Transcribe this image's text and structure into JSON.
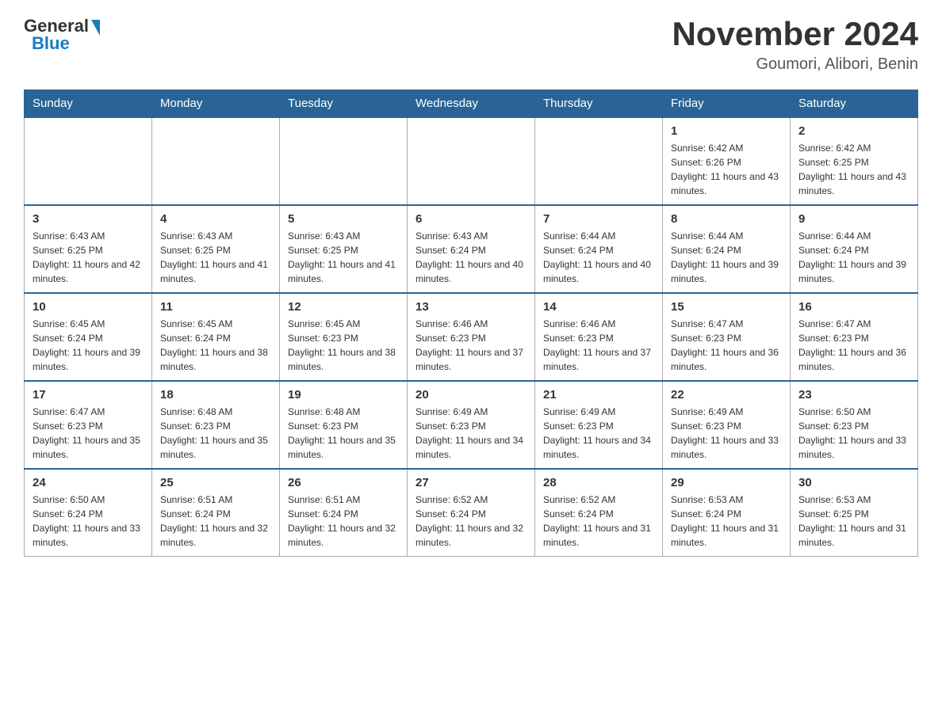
{
  "logo": {
    "general": "General",
    "blue": "Blue"
  },
  "title": "November 2024",
  "subtitle": "Goumori, Alibori, Benin",
  "days_of_week": [
    "Sunday",
    "Monday",
    "Tuesday",
    "Wednesday",
    "Thursday",
    "Friday",
    "Saturday"
  ],
  "weeks": [
    [
      {
        "day": "",
        "info": ""
      },
      {
        "day": "",
        "info": ""
      },
      {
        "day": "",
        "info": ""
      },
      {
        "day": "",
        "info": ""
      },
      {
        "day": "",
        "info": ""
      },
      {
        "day": "1",
        "info": "Sunrise: 6:42 AM\nSunset: 6:26 PM\nDaylight: 11 hours and 43 minutes."
      },
      {
        "day": "2",
        "info": "Sunrise: 6:42 AM\nSunset: 6:25 PM\nDaylight: 11 hours and 43 minutes."
      }
    ],
    [
      {
        "day": "3",
        "info": "Sunrise: 6:43 AM\nSunset: 6:25 PM\nDaylight: 11 hours and 42 minutes."
      },
      {
        "day": "4",
        "info": "Sunrise: 6:43 AM\nSunset: 6:25 PM\nDaylight: 11 hours and 41 minutes."
      },
      {
        "day": "5",
        "info": "Sunrise: 6:43 AM\nSunset: 6:25 PM\nDaylight: 11 hours and 41 minutes."
      },
      {
        "day": "6",
        "info": "Sunrise: 6:43 AM\nSunset: 6:24 PM\nDaylight: 11 hours and 40 minutes."
      },
      {
        "day": "7",
        "info": "Sunrise: 6:44 AM\nSunset: 6:24 PM\nDaylight: 11 hours and 40 minutes."
      },
      {
        "day": "8",
        "info": "Sunrise: 6:44 AM\nSunset: 6:24 PM\nDaylight: 11 hours and 39 minutes."
      },
      {
        "day": "9",
        "info": "Sunrise: 6:44 AM\nSunset: 6:24 PM\nDaylight: 11 hours and 39 minutes."
      }
    ],
    [
      {
        "day": "10",
        "info": "Sunrise: 6:45 AM\nSunset: 6:24 PM\nDaylight: 11 hours and 39 minutes."
      },
      {
        "day": "11",
        "info": "Sunrise: 6:45 AM\nSunset: 6:24 PM\nDaylight: 11 hours and 38 minutes."
      },
      {
        "day": "12",
        "info": "Sunrise: 6:45 AM\nSunset: 6:23 PM\nDaylight: 11 hours and 38 minutes."
      },
      {
        "day": "13",
        "info": "Sunrise: 6:46 AM\nSunset: 6:23 PM\nDaylight: 11 hours and 37 minutes."
      },
      {
        "day": "14",
        "info": "Sunrise: 6:46 AM\nSunset: 6:23 PM\nDaylight: 11 hours and 37 minutes."
      },
      {
        "day": "15",
        "info": "Sunrise: 6:47 AM\nSunset: 6:23 PM\nDaylight: 11 hours and 36 minutes."
      },
      {
        "day": "16",
        "info": "Sunrise: 6:47 AM\nSunset: 6:23 PM\nDaylight: 11 hours and 36 minutes."
      }
    ],
    [
      {
        "day": "17",
        "info": "Sunrise: 6:47 AM\nSunset: 6:23 PM\nDaylight: 11 hours and 35 minutes."
      },
      {
        "day": "18",
        "info": "Sunrise: 6:48 AM\nSunset: 6:23 PM\nDaylight: 11 hours and 35 minutes."
      },
      {
        "day": "19",
        "info": "Sunrise: 6:48 AM\nSunset: 6:23 PM\nDaylight: 11 hours and 35 minutes."
      },
      {
        "day": "20",
        "info": "Sunrise: 6:49 AM\nSunset: 6:23 PM\nDaylight: 11 hours and 34 minutes."
      },
      {
        "day": "21",
        "info": "Sunrise: 6:49 AM\nSunset: 6:23 PM\nDaylight: 11 hours and 34 minutes."
      },
      {
        "day": "22",
        "info": "Sunrise: 6:49 AM\nSunset: 6:23 PM\nDaylight: 11 hours and 33 minutes."
      },
      {
        "day": "23",
        "info": "Sunrise: 6:50 AM\nSunset: 6:23 PM\nDaylight: 11 hours and 33 minutes."
      }
    ],
    [
      {
        "day": "24",
        "info": "Sunrise: 6:50 AM\nSunset: 6:24 PM\nDaylight: 11 hours and 33 minutes."
      },
      {
        "day": "25",
        "info": "Sunrise: 6:51 AM\nSunset: 6:24 PM\nDaylight: 11 hours and 32 minutes."
      },
      {
        "day": "26",
        "info": "Sunrise: 6:51 AM\nSunset: 6:24 PM\nDaylight: 11 hours and 32 minutes."
      },
      {
        "day": "27",
        "info": "Sunrise: 6:52 AM\nSunset: 6:24 PM\nDaylight: 11 hours and 32 minutes."
      },
      {
        "day": "28",
        "info": "Sunrise: 6:52 AM\nSunset: 6:24 PM\nDaylight: 11 hours and 31 minutes."
      },
      {
        "day": "29",
        "info": "Sunrise: 6:53 AM\nSunset: 6:24 PM\nDaylight: 11 hours and 31 minutes."
      },
      {
        "day": "30",
        "info": "Sunrise: 6:53 AM\nSunset: 6:25 PM\nDaylight: 11 hours and 31 minutes."
      }
    ]
  ]
}
